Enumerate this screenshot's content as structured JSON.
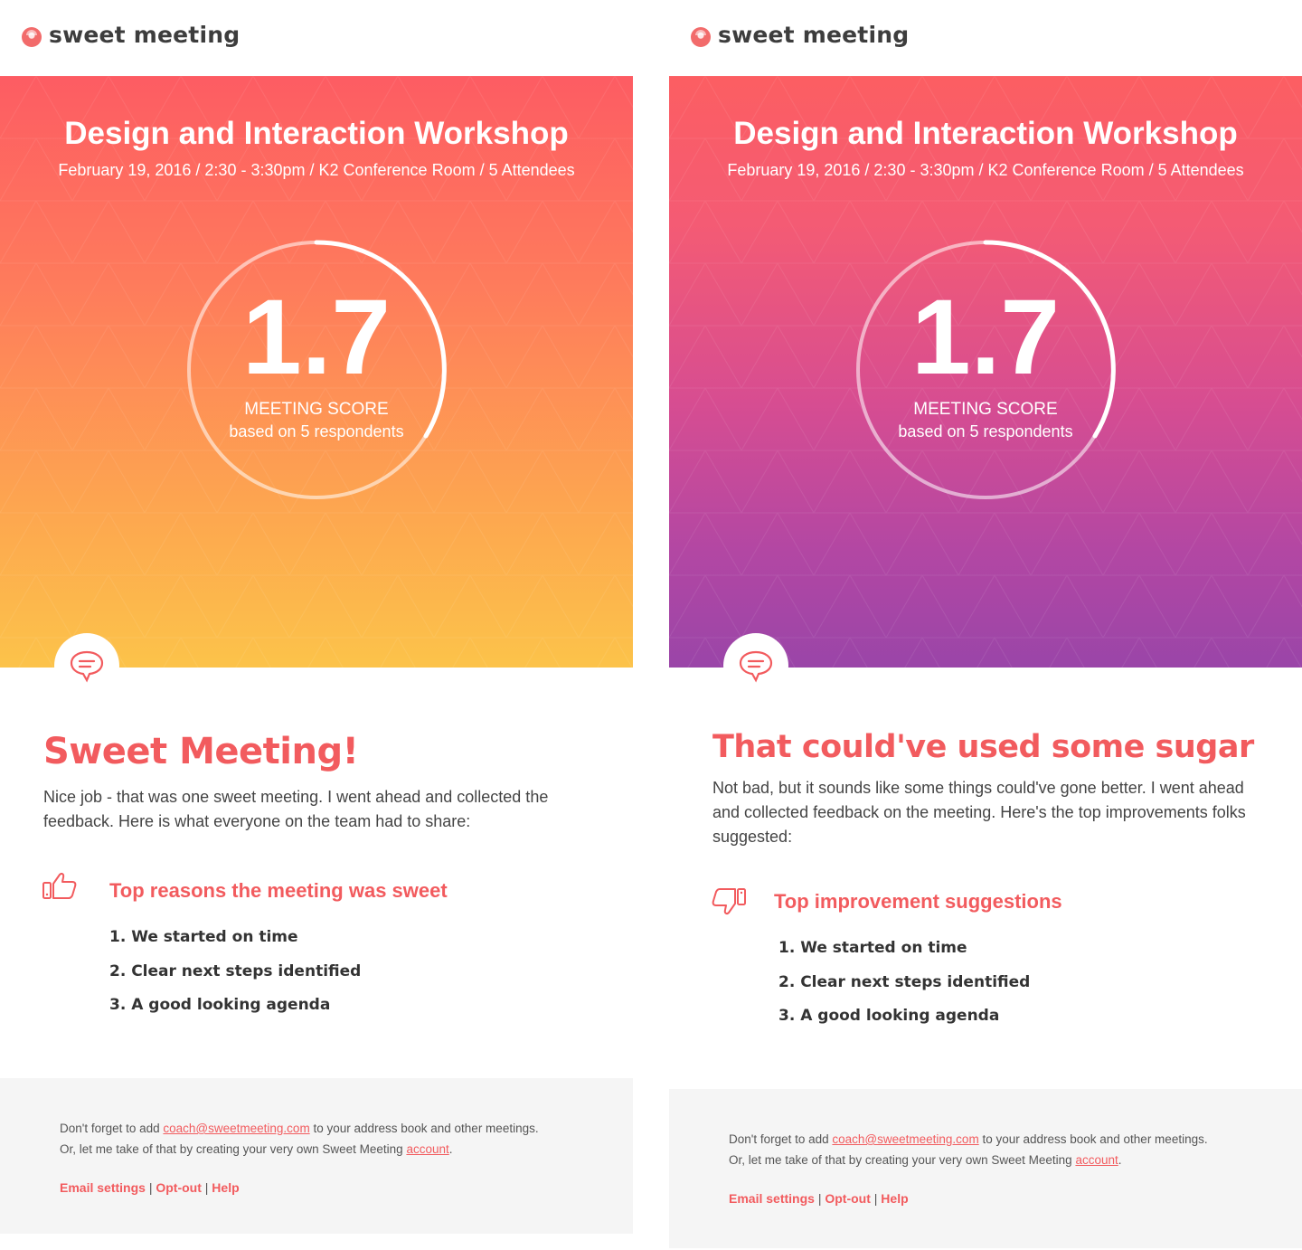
{
  "brand": {
    "name": "sweet meeting"
  },
  "colors": {
    "accent": "#f25b5e",
    "hero_warm_top": "#fd5c63",
    "hero_warm_bottom": "#fcc34a",
    "hero_purple_top": "#fc5e62",
    "hero_purple_bottom": "#9a45a8",
    "footer_bg": "#f5f5f5"
  },
  "meeting": {
    "title": "Design and Interaction Workshop",
    "details": "February 19, 2016 / 2:30 - 3:30pm / K2 Conference Room / 5 Attendees",
    "score": "1.7",
    "score_label": "MEETING SCORE",
    "score_sub": "based on 5 respondents"
  },
  "emails": [
    {
      "variant": "positive",
      "headline": "Sweet Meeting!",
      "lead": "Nice job - that was one sweet meeting. I went ahead and collected the feedback. Here is what everyone on the team had to share:",
      "section_icon": "thumbs-up-icon",
      "section_title": "Top reasons the meeting was sweet",
      "items": [
        "1. We started on time",
        "2. Clear next steps identified",
        "3. A good looking agenda"
      ]
    },
    {
      "variant": "improvement",
      "headline": "That could've used some sugar",
      "lead": "Not bad, but it sounds like some things could've gone better. I went ahead and collected feedback on the meeting. Here's the top improvements folks suggested:",
      "section_icon": "thumbs-down-icon",
      "section_title": "Top improvement suggestions",
      "items": [
        "1. We started on time",
        "2. Clear next steps identified",
        "3. A good looking agenda"
      ]
    }
  ],
  "footer": {
    "line1_before": "Don't forget to add ",
    "email_link": "coach@sweetmeeting.com",
    "line1_after": " to your address book and other meetings.",
    "line2_before": "Or, let me take of that by creating your very own Sweet Meeting ",
    "account_link": "account",
    "line2_after": ".",
    "email_settings": "Email settings",
    "opt_out": "Opt-out",
    "help": "Help",
    "separator": "|"
  },
  "icons": {
    "logo": "sweet-meeting-logo-icon",
    "chat": "chat-bubble-icon"
  }
}
